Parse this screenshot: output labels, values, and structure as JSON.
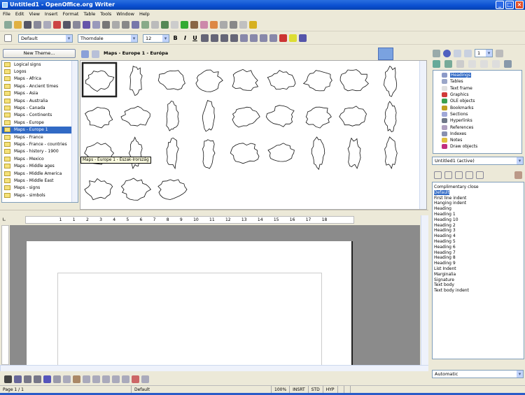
{
  "window": {
    "title": "Untitled1 - OpenOffice.org Writer",
    "min": "_",
    "max": "□",
    "close": "×"
  },
  "menu": [
    "File",
    "Edit",
    "View",
    "Insert",
    "Format",
    "Table",
    "Tools",
    "Window",
    "Help"
  ],
  "formatting": {
    "style": "Default",
    "font": "Thorndale",
    "size": "12",
    "bold": "B",
    "italic": "I",
    "underline": "U"
  },
  "gallery": {
    "new_theme": "New Theme...",
    "title": "Maps - Europe 1 - Európa",
    "tooltip": "Maps - Europe 1 - Észak-Írország",
    "themes": [
      "Logical signs",
      "Logos",
      "Maps - Africa",
      "Maps - Ancient times",
      "Maps - Asia",
      "Maps - Australia",
      "Maps - Canada",
      "Maps - Continents",
      "Maps - Europe",
      "Maps - Europe 1",
      "Maps - France",
      "Maps - France - countries",
      "Maps - history - 1900",
      "Maps - Mexico",
      "Maps - Middle ages",
      "Maps - Middle America",
      "Maps - Middle East",
      "Maps - signs",
      "Maps - simbols"
    ],
    "selected_theme": "Maps - Europe 1"
  },
  "navigator": {
    "page": "1",
    "items": [
      {
        "label": "Headings",
        "color": "#8c9ac8"
      },
      {
        "label": "Tables",
        "color": "#9aa6c8"
      },
      {
        "label": "Text frame",
        "color": "#e0e0e0"
      },
      {
        "label": "Graphics",
        "color": "#d03a3a"
      },
      {
        "label": "OLE objects",
        "color": "#3aa050"
      },
      {
        "label": "Bookmarks",
        "color": "#c0a020"
      },
      {
        "label": "Sections",
        "color": "#a0a8d8"
      },
      {
        "label": "Hyperlinks",
        "color": "#707888"
      },
      {
        "label": "References",
        "color": "#b0a0c0"
      },
      {
        "label": "Indexes",
        "color": "#8890b0"
      },
      {
        "label": "Notes",
        "color": "#e0c040"
      },
      {
        "label": "Draw objects",
        "color": "#c03080"
      }
    ],
    "document": "Untitled1 (active)"
  },
  "styles": {
    "items": [
      "Complimentary close",
      "Default",
      "First line indent",
      "Hanging indent",
      "Heading",
      "Heading 1",
      "Heading 10",
      "Heading 2",
      "Heading 3",
      "Heading 4",
      "Heading 5",
      "Heading 6",
      "Heading 7",
      "Heading 8",
      "Heading 9",
      "List Indent",
      "Marginalia",
      "Signature",
      "Text body",
      "Text body indent"
    ],
    "selected": "Default",
    "filter": "Automatic"
  },
  "ruler": [
    "1",
    "1",
    "2",
    "3",
    "4",
    "5",
    "6",
    "7",
    "8",
    "9",
    "10",
    "11",
    "12",
    "13",
    "14",
    "15",
    "16",
    "17",
    "18"
  ],
  "status": {
    "page": "Page 1 / 1",
    "style": "Default",
    "zoom": "100%",
    "mode": "INSRT",
    "sel": "STD",
    "hyp": "HYP"
  }
}
